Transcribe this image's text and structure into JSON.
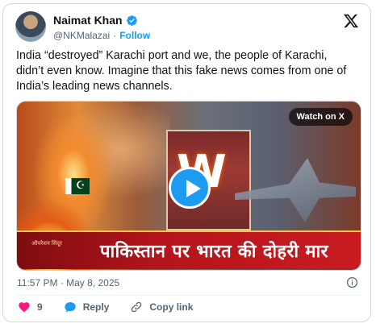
{
  "author": {
    "name": "Naimat Khan",
    "handle": "@NKMalazai",
    "separator": "·",
    "follow_label": "Follow"
  },
  "tweet": {
    "text": "India “destroyed” Karachi port  and we, the people of Karachi, didn’t even know. Imagine that this fake news comes from one of India’s leading news channels."
  },
  "media": {
    "watch_label": "Watch on X",
    "banner_text": "पाकिस्तान पर भारत की दोहरी मार",
    "banner_logo_text": "ऑपरेशन सिंदूर"
  },
  "meta": {
    "timestamp": "11:57 PM · May 8, 2025"
  },
  "actions": {
    "like_count": "9",
    "reply_label": "Reply",
    "copy_link_label": "Copy link"
  },
  "colors": {
    "accent": "#1d9bf0",
    "like": "#f91880",
    "text": "#0f1419",
    "secondary": "#536471"
  },
  "icons": [
    "verified-badge-icon",
    "x-logo-icon",
    "play-icon",
    "info-icon",
    "heart-icon",
    "reply-icon",
    "link-icon"
  ]
}
